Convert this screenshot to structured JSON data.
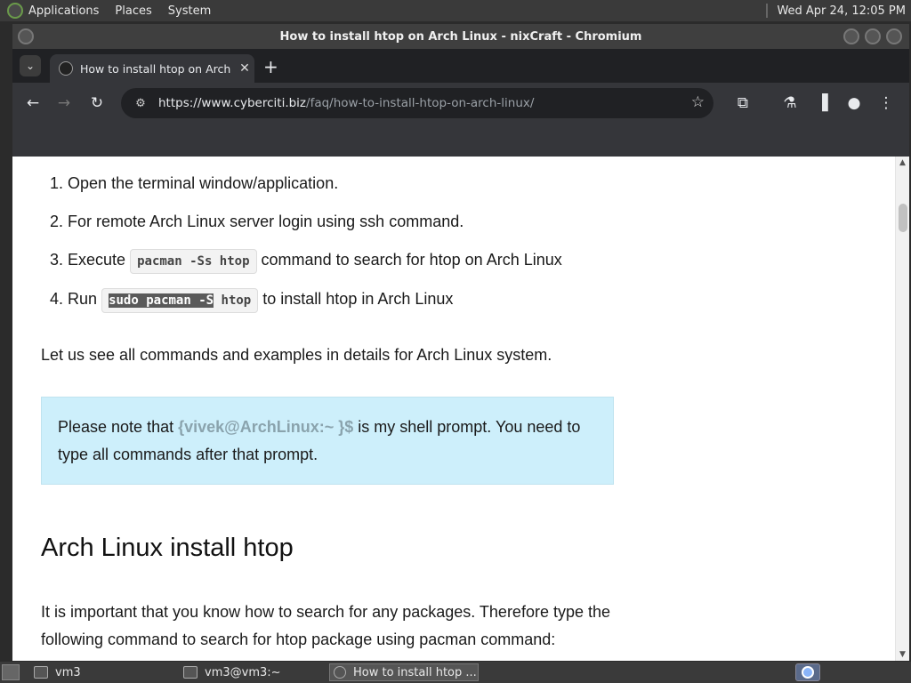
{
  "top_panel": {
    "menus": [
      "Applications",
      "Places",
      "System"
    ],
    "clock": "Wed Apr 24, 12:05 PM"
  },
  "window": {
    "title": "How to install htop on Arch Linux - nixCraft - Chromium"
  },
  "browser": {
    "tab_title": "How to install htop on Arch L",
    "new_tab": "+",
    "url_host": "https://www.cyberciti.biz",
    "url_path": "/faq/how-to-install-htop-on-arch-linux/"
  },
  "page": {
    "steps": [
      {
        "num": "1.",
        "text": "Open the terminal window/application."
      },
      {
        "num": "2.",
        "text": "For remote Arch Linux server login using ssh command."
      },
      {
        "num": "3.",
        "pre": "Execute",
        "code": "pacman -Ss htop",
        "post": "command to search for htop on Arch Linux"
      },
      {
        "num": "4.",
        "pre": "Run",
        "code_selected": "sudo pacman -S",
        "code_rest": " htop",
        "post": "to install htop in Arch Linux"
      }
    ],
    "intro": "Let us see all commands and examples in details for Arch Linux system.",
    "note_pre": "Please note that ",
    "note_prompt": "{vivek@ArchLinux:~ }$",
    "note_post": " is my shell prompt. You need to type all commands after that prompt.",
    "heading": "Arch Linux install htop",
    "para": "It is important that you know how to search for any packages. Therefore type the following command to search for htop package using pacman command:"
  },
  "taskbar": {
    "items": [
      "vm3",
      "vm3@vm3:~",
      "How to install htop ..."
    ]
  },
  "colors": {
    "note_bg": "#cdeffb",
    "omnibox_bg": "#202124",
    "toolbar_bg": "#35363a"
  }
}
